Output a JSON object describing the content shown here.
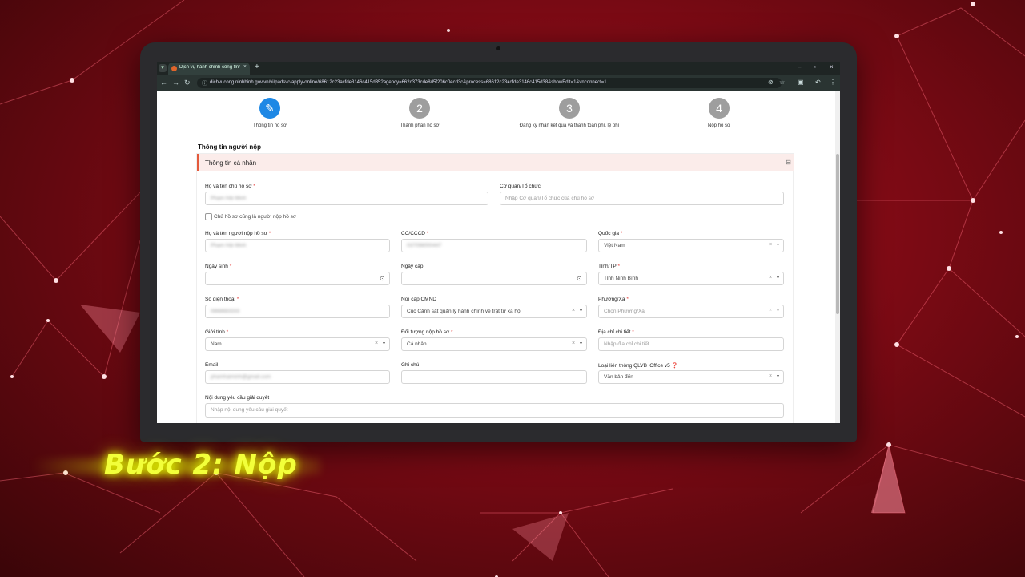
{
  "browser": {
    "tab_title": "Dịch vụ hành chính công tỉnh N",
    "url": "dichvucong.ninhbinh.gov.vn/vi/padsvc/apply-online/68612c23acfde3146c415d35?agency=662c373cde8d5f206c0ecd3c&process=68612c23acfde3146c415d38&showEdit=1&vnconnect=1"
  },
  "steps": [
    {
      "num": "",
      "label": "Thông tin hồ sơ"
    },
    {
      "num": "2",
      "label": "Thành phần hồ sơ"
    },
    {
      "num": "3",
      "label": "Đăng ký nhận kết quả và thanh toán phí, lệ phí"
    },
    {
      "num": "4",
      "label": "Nộp hồ sơ"
    }
  ],
  "section_title": "Thông tin người nộp",
  "panel_title": "Thông tin cá nhân",
  "form": {
    "owner_name": {
      "label": "Họ và tên chủ hồ sơ",
      "value": "Phạm Hải Minh"
    },
    "org": {
      "label": "Cơ quan/Tổ chức",
      "placeholder": "Nhập Cơ quan/Tổ chức của chủ hồ sơ"
    },
    "same_person": {
      "label": "Chủ hồ sơ cũng là người nộp hồ sơ"
    },
    "submitter_name": {
      "label": "Họ và tên người nộp hồ sơ",
      "value": "Phạm Hải Minh"
    },
    "id_card": {
      "label": "CC/CCCD",
      "value": "037098000447"
    },
    "nationality": {
      "label": "Quốc gia",
      "value": "Việt Nam"
    },
    "dob": {
      "label": "Ngày sinh",
      "value": ""
    },
    "issue_date": {
      "label": "Ngày cấp",
      "value": ""
    },
    "province": {
      "label": "Tỉnh/TP",
      "value": "Tỉnh Ninh Bình"
    },
    "phone": {
      "label": "Số điện thoại",
      "value": "0868683333"
    },
    "issue_place": {
      "label": "Nơi cấp CMND",
      "value": "Cục Cảnh sát quản lý hành chính về trật tự xã hội"
    },
    "ward": {
      "label": "Phường/Xã",
      "placeholder": "Chọn Phường/Xã"
    },
    "gender": {
      "label": "Giới tính",
      "value": "Nam"
    },
    "subject": {
      "label": "Đối tượng nộp hồ sơ",
      "value": "Cá nhân"
    },
    "address": {
      "label": "Địa chỉ chi tiết",
      "placeholder": "Nhập địa chỉ chi tiết"
    },
    "email": {
      "label": "Email",
      "value": "phamhaiminh@gmail.com"
    },
    "note": {
      "label": "Ghi chú",
      "value": ""
    },
    "link_type": {
      "label": "Loại liên thông QLVB iOffice v5",
      "value": "Văn bản đến"
    },
    "content": {
      "label": "Nội dung yêu cầu giải quyết",
      "placeholder": "Nhập nội dung yêu cầu giải quyết"
    }
  },
  "required_mark": "*",
  "banner": "Bước 2: Nộp"
}
